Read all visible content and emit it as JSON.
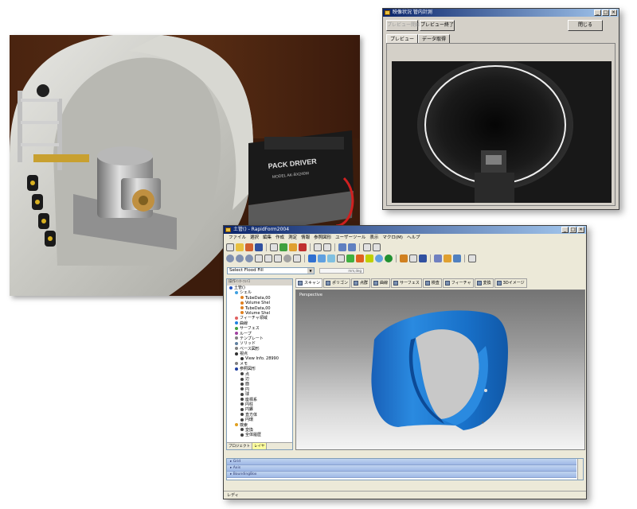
{
  "preview_window": {
    "title": "映像状況 管内計測",
    "buttons": {
      "preview_start": "プレビュー開始",
      "preview_end": "プレビュー終了",
      "close": "閉じる"
    },
    "tabs": [
      "プレビュー",
      "データ取得"
    ]
  },
  "photo": {
    "driver_brand": "PACK DRIVER",
    "driver_model": "MODEL AK-BX240M"
  },
  "main_window": {
    "title": "土管() - RapidForm2004",
    "menus": [
      "ファイル",
      "選択",
      "編集",
      "作成",
      "測定",
      "情報",
      "参照図形",
      "ユーザーツール",
      "表示",
      "マクロ(M)",
      "ヘルプ"
    ],
    "select_value": "Select Flood Fill",
    "select_small": "mm,deg",
    "tree_header": "操作ｲﾝﾀｰﾌｪｲｽ",
    "tree": [
      {
        "label": "土管()",
        "indent": 0,
        "color": "#2050c0"
      },
      {
        "label": "シェル",
        "indent": 1,
        "color": "#40a0e0"
      },
      {
        "label": "TubeData,00",
        "indent": 2,
        "color": "#e08020"
      },
      {
        "label": "Volume Shel",
        "indent": 2,
        "color": "#e08020"
      },
      {
        "label": "TubeData,00",
        "indent": 2,
        "color": "#e08020"
      },
      {
        "label": "Volume Shel",
        "indent": 2,
        "color": "#e08020"
      },
      {
        "label": "フィーチャ領域",
        "indent": 1,
        "color": "#e06060"
      },
      {
        "label": "曲線",
        "indent": 1,
        "color": "#2080e0"
      },
      {
        "label": "サーフェス",
        "indent": 1,
        "color": "#40a040"
      },
      {
        "label": "ループ",
        "indent": 1,
        "color": "#a040a0"
      },
      {
        "label": "テンプレート",
        "indent": 1,
        "color": "#808080"
      },
      {
        "label": "ソリッド",
        "indent": 1,
        "color": "#6080a0"
      },
      {
        "label": "ベース図形",
        "indent": 1,
        "color": "#808080"
      },
      {
        "label": "視点",
        "indent": 1,
        "color": "#303030"
      },
      {
        "label": "View Info. 28990",
        "indent": 2,
        "color": "#303030"
      },
      {
        "label": "メモ",
        "indent": 1,
        "color": "#808080"
      },
      {
        "label": "参照図形",
        "indent": 1,
        "color": "#2040a0"
      },
      {
        "label": "点",
        "indent": 2,
        "color": "#404040"
      },
      {
        "label": "辺",
        "indent": 2,
        "color": "#404040"
      },
      {
        "label": "面",
        "indent": 2,
        "color": "#404040"
      },
      {
        "label": "円",
        "indent": 2,
        "color": "#404040"
      },
      {
        "label": "球",
        "indent": 2,
        "color": "#404040"
      },
      {
        "label": "座標系",
        "indent": 2,
        "color": "#404040"
      },
      {
        "label": "円柱",
        "indent": 2,
        "color": "#404040"
      },
      {
        "label": "円錐",
        "indent": 2,
        "color": "#404040"
      },
      {
        "label": "直方体",
        "indent": 2,
        "color": "#404040"
      },
      {
        "label": "円環",
        "indent": 2,
        "color": "#404040"
      },
      {
        "label": "検索",
        "indent": 1,
        "color": "#e0a020"
      },
      {
        "label": "変換",
        "indent": 2,
        "color": "#404040"
      },
      {
        "label": "全体履歴",
        "indent": 2,
        "color": "#404040"
      }
    ],
    "tree_tabs": [
      "プロジェクト",
      "レイヤ"
    ],
    "view_tabs": [
      "スキャン",
      "ポリゴン",
      "点群",
      "曲線",
      "サーフェス",
      "検査",
      "フィーチャ",
      "変換",
      "3Dイメージ"
    ],
    "viewport_label": "Perspective",
    "log_rows": [
      "Grid",
      "Axis",
      "BoundingBox"
    ],
    "status": "レディ"
  }
}
